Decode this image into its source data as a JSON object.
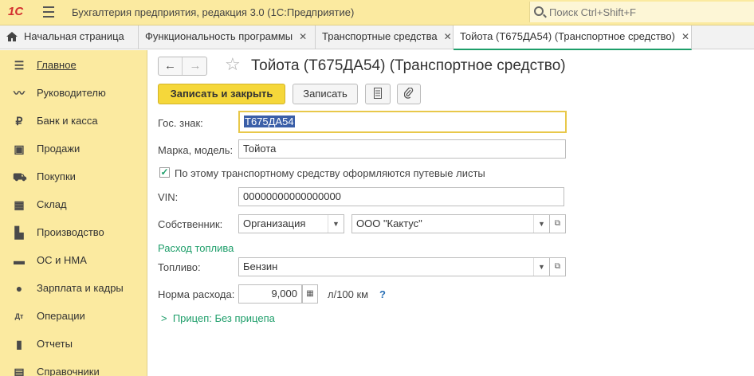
{
  "app": {
    "logo": "1С",
    "title": "Бухгалтерия предприятия, редакция 3.0  (1С:Предприятие)",
    "search_placeholder": "Поиск Ctrl+Shift+F"
  },
  "tabs": [
    {
      "label": "Начальная страница"
    },
    {
      "label": "Функциональность программы",
      "close": "✕"
    },
    {
      "label": "Транспортные средства",
      "close": "✕"
    },
    {
      "label": "Тойота (Т675ДА54) (Транспортное средство)",
      "close": "✕"
    }
  ],
  "sidebar": {
    "items": [
      {
        "label": "Главное",
        "icon": "menu-icon"
      },
      {
        "label": "Руководителю",
        "icon": "chart-line-icon"
      },
      {
        "label": "Банк и касса",
        "icon": "ruble-icon"
      },
      {
        "label": "Продажи",
        "icon": "shopping-bag-icon"
      },
      {
        "label": "Покупки",
        "icon": "cart-icon"
      },
      {
        "label": "Склад",
        "icon": "warehouse-icon"
      },
      {
        "label": "Производство",
        "icon": "factory-icon"
      },
      {
        "label": "ОС и НМА",
        "icon": "truck-icon"
      },
      {
        "label": "Зарплата и кадры",
        "icon": "person-icon"
      },
      {
        "label": "Операции",
        "icon": "operations-icon"
      },
      {
        "label": "Отчеты",
        "icon": "report-icon"
      },
      {
        "label": "Справочники",
        "icon": "book-icon"
      }
    ]
  },
  "form": {
    "title": "Тойота (Т675ДА54) (Транспортное средство)",
    "buttons": {
      "save_close": "Записать и закрыть",
      "save": "Записать"
    },
    "gos_znak": {
      "label": "Гос. знак:",
      "value": "Т675ДА54"
    },
    "model": {
      "label": "Марка, модель:",
      "value": "Тойота"
    },
    "waybill": {
      "label": "По этому транспортному средству оформляются путевые листы",
      "checked": true
    },
    "vin": {
      "label": "VIN:",
      "value": "00000000000000000"
    },
    "owner": {
      "label": "Собственник:",
      "type": "Организация",
      "name": "ООО \"Кактус\""
    },
    "fuel_section": "Расход топлива",
    "fuel": {
      "label": "Топливо:",
      "value": "Бензин"
    },
    "norm": {
      "label": "Норма расхода:",
      "value": "9,000",
      "unit": "л/100 км",
      "help": "?"
    },
    "trailer_link": "Прицеп: Без прицепа"
  }
}
